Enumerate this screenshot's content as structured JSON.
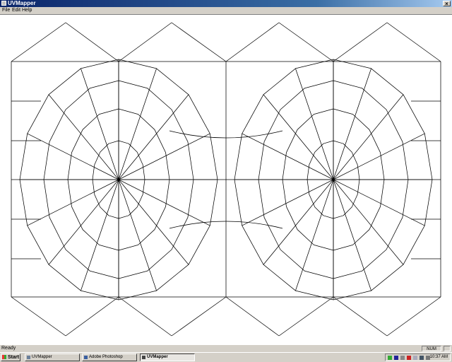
{
  "window": {
    "title": "UVMapper",
    "close_glyph": "×"
  },
  "menu": {
    "file": "File",
    "edit": "Edit",
    "help": "Help"
  },
  "status": {
    "text": "Ready",
    "num": "NUM"
  },
  "taskbar": {
    "start": "Start",
    "tasks": [
      {
        "label": "UVMapper",
        "active": false
      },
      {
        "label": "Adobe Photoshop",
        "active": false
      },
      {
        "label": "UVMapper",
        "active": true
      }
    ],
    "clock": "10:37 AM"
  },
  "tray_icons": [
    "shield-icon",
    "network-icon",
    "gear-icon",
    "red-square-icon",
    "window-icon",
    "monitor-icon",
    "speaker-icon"
  ],
  "colors": {
    "titlebar": "#0a246a",
    "wire": "#000000",
    "canvas": "#ffffff"
  }
}
